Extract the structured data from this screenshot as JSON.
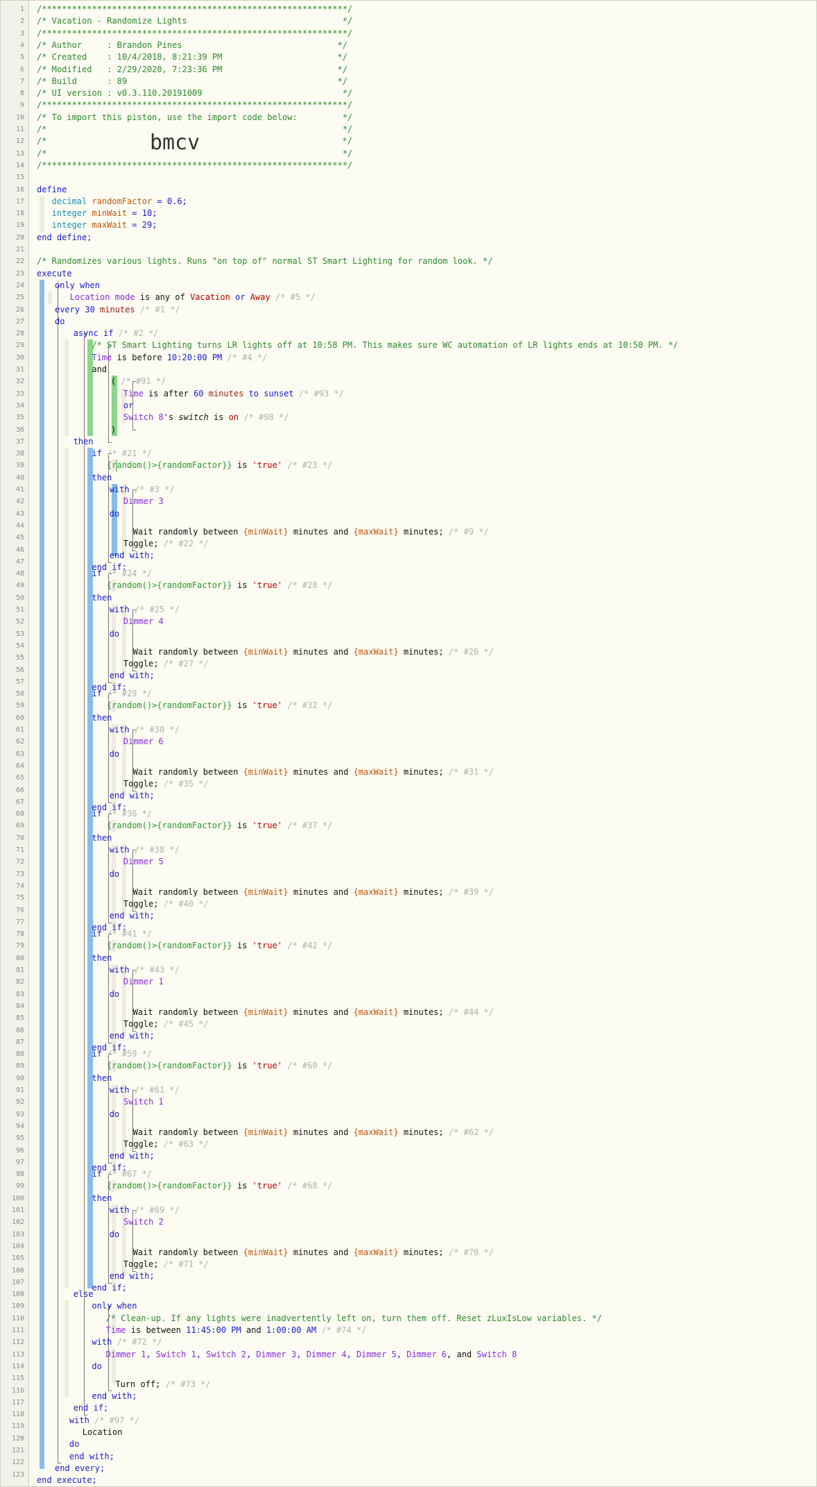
{
  "piston": {
    "header_border": "/*************************************************************/",
    "header_blank": "/*                                                           */",
    "title_line": "/* Vacation - Randomize Lights                               */",
    "author_line": "/* Author     : Brandon Pines                               */",
    "created_line": "/* Created    : 10/4/2018, 8:21:39 PM                       */",
    "modified_line": "/* Modified   : 2/29/2020, 7:23:36 PM                       */",
    "build_line": "/* Build      : 89                                          */",
    "ui_line": "/* UI version : v0.3.110.20191009                            */",
    "import_line": "/* To import this piston, use the import code below:         */",
    "import_code": "bmcv",
    "import_left": "/*",
    "import_right": "*/"
  },
  "colors": {
    "background": "#fcfcf2",
    "comment": "#2c8a2c",
    "keyword": "#1a1acc",
    "type": "#1a8fb0",
    "variable": "#c0580c",
    "device": "#8a2be2",
    "string": "#b40000",
    "ghost": "#b0b0b0",
    "block_bar_blue": "#87bee9",
    "block_bar_green": "#8ad68a"
  },
  "line_numbers": [
    "1",
    "2",
    "3",
    "4",
    "5",
    "6",
    "7",
    "8",
    "9",
    "10",
    "11",
    "12",
    "13",
    "14",
    "15",
    "16",
    "17",
    "18",
    "19",
    "20",
    "21",
    "22",
    "23",
    "24",
    "25",
    "26",
    "27",
    "28",
    "29",
    "30",
    "31",
    "32",
    "33",
    "34",
    "35",
    "36",
    "37",
    "38",
    "39",
    "40",
    "41",
    "42",
    "43",
    "44",
    "45",
    "46",
    "47",
    "48",
    "49",
    "50",
    "51",
    "52",
    "53",
    "54",
    "55",
    "56",
    "57",
    "58",
    "59",
    "60",
    "61",
    "62",
    "63",
    "64",
    "65",
    "66",
    "67",
    "68",
    "69",
    "70",
    "71",
    "72",
    "73",
    "74",
    "75",
    "76",
    "77",
    "78",
    "79",
    "80",
    "81",
    "82",
    "83",
    "84",
    "85",
    "86",
    "87",
    "88",
    "89",
    "90",
    "91",
    "92",
    "93",
    "94",
    "95",
    "96",
    "97",
    "98",
    "99",
    "100",
    "101",
    "102",
    "103",
    "104",
    "105",
    "106",
    "107",
    "108",
    "109",
    "110",
    "111",
    "112",
    "113",
    "114",
    "115",
    "116",
    "117",
    "118",
    "119",
    "120",
    "121",
    "122",
    "123"
  ],
  "define": {
    "kw_define": "define",
    "vars": [
      {
        "type": "decimal",
        "name": "randomFactor",
        "value": "0.6"
      },
      {
        "type": "integer",
        "name": "minWait",
        "value": "10"
      },
      {
        "type": "integer",
        "name": "maxWait",
        "value": "29"
      }
    ],
    "kw_end": "end define;"
  },
  "description_comment": "/* Randomizes various lights. Runs \"on top of\" normal ST Smart Lighting for random look. */",
  "execute": {
    "kw_execute": "execute",
    "only_when": "only when",
    "location_mode": "Location mode",
    "is_any_of": "is any of",
    "mode_vacation": "Vacation",
    "or_word": "or",
    "mode_away": "Away",
    "c5": "/* #5 */",
    "every": "every",
    "every_n": "30",
    "every_unit": "minutes",
    "c1": "/* #1 */",
    "do_kw": "do",
    "async_if": "async if",
    "c2": "/* #2 */",
    "smart_comment": "/* ST Smart Lighting turns LR lights off at 10:58 PM. This makes sure WC automation of LR lights ends at 10:50 PM. */",
    "time_word": "Time",
    "is_before": "is before",
    "before_time": "10:20:00 PM",
    "c4": "/* #4 */",
    "and_word": "and",
    "paren_open": "(",
    "c91": "/* #91 */",
    "is_after": "is after",
    "after_n": "60",
    "after_unit": "minutes",
    "to_word": "to",
    "sunset": "sunset",
    "c93": "/* #93 */",
    "switch8": "Switch 8",
    "apos_s": "'s",
    "switch_attr": "switch",
    "is_word": "is",
    "on_word": "on",
    "c98": "/* #98 */",
    "paren_close": ")",
    "then_kw": "then",
    "rand_expr": "{random()>{randomFactor}}",
    "true_str": "'true'",
    "with_kw": "with",
    "wait_text": "Wait randomly between",
    "min_wait": "{minWait}",
    "minutes_and": "minutes and",
    "max_wait": "{maxWait}",
    "minutes_end": "minutes;",
    "toggle": "Toggle;",
    "end_with": "end with;",
    "end_if": "end if;",
    "if_kw": "if",
    "blocks": [
      {
        "if_c": "/* #21 */",
        "expr_c": "/* #23 */",
        "with_c": "/* #3 */",
        "device": "Dimmer 3",
        "wait_c": "/* #9 */",
        "toggle_c": "/* #22 */"
      },
      {
        "if_c": "/* #24 */",
        "expr_c": "/* #28 */",
        "with_c": "/* #25 */",
        "device": "Dimmer 4",
        "wait_c": "/* #26 */",
        "toggle_c": "/* #27 */"
      },
      {
        "if_c": "/* #29 */",
        "expr_c": "/* #32 */",
        "with_c": "/* #30 */",
        "device": "Dimmer 6",
        "wait_c": "/* #31 */",
        "toggle_c": "/* #35 */"
      },
      {
        "if_c": "/* #36 */",
        "expr_c": "/* #37 */",
        "with_c": "/* #38 */",
        "device": "Dimmer 5",
        "wait_c": "/* #39 */",
        "toggle_c": "/* #40 */"
      },
      {
        "if_c": "/* #41 */",
        "expr_c": "/* #42 */",
        "with_c": "/* #43 */",
        "device": "Dimmer 1",
        "wait_c": "/* #44 */",
        "toggle_c": "/* #45 */"
      },
      {
        "if_c": "/* #59 */",
        "expr_c": "/* #60 */",
        "with_c": "/* #61 */",
        "device": "Switch 1",
        "wait_c": "/* #62 */",
        "toggle_c": "/* #63 */"
      },
      {
        "if_c": "/* #67 */",
        "expr_c": "/* #68 */",
        "with_c": "/* #69 */",
        "device": "Switch 2",
        "wait_c": "/* #70 */",
        "toggle_c": "/* #71 */"
      }
    ],
    "else_kw": "else",
    "cleanup_comment": "/* Clean-up. If any lights were inadvertently left on, turn them off. Reset zLuxIsLow variables. */",
    "is_between": "is between",
    "between_start": "11:45:00 PM",
    "between_end": "1:00:00 AM",
    "c74": "/* #74 */",
    "c72": "/* #72 */",
    "devices": [
      "Dimmer 1",
      "Switch 1",
      "Switch 2",
      "Dimmer 3",
      "Dimmer 4",
      "Dimmer 5",
      "Dimmer 6"
    ],
    "comma": ",",
    "and_last": ", and",
    "last_device": "Switch 8",
    "turn_off": "Turn off;",
    "c73": "/* #73 */",
    "c97": "/* #97 */",
    "location": "Location",
    "end_every": "end every;",
    "end_execute": "end execute;"
  }
}
